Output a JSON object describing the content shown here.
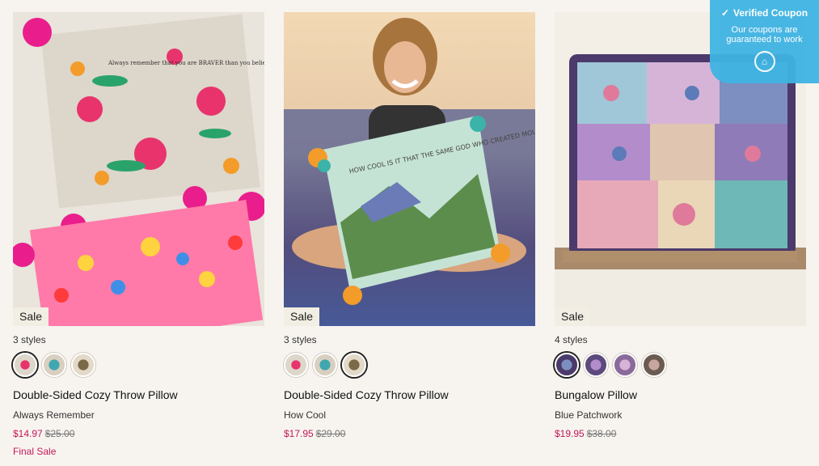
{
  "products": [
    {
      "sale_badge": "Sale",
      "styles_count": "3 styles",
      "title": "Double-Sided Cozy Throw Pillow",
      "variant": "Always Remember",
      "price_now": "$14.97",
      "price_was": "$25.00",
      "final_sale": "Final Sale",
      "pillow_text": "Always remember that you are BRAVER than you believe, STRONGER than you seem, SMARTER than you think and LOVED more than you'll ever know"
    },
    {
      "sale_badge": "Sale",
      "styles_count": "3 styles",
      "title": "Double-Sided Cozy Throw Pillow",
      "variant": "How Cool",
      "price_now": "$17.95",
      "price_was": "$29.00",
      "pillow_text": "HOW COOL IS IT THAT THE SAME GOD WHO CREATED MOUNTAINS AND OCEANS AND GALAXIES LOOKED AT YOU AND THOUGHT THE WORLD NEEDED ONE OF YOU TOO."
    },
    {
      "sale_badge": "Sale",
      "styles_count": "4 styles",
      "title": "Bungalow Pillow",
      "variant": "Blue Patchwork",
      "price_now": "$19.95",
      "price_was": "$38.00"
    }
  ],
  "coupon": {
    "title": "Verified Coupon",
    "text": "Our coupons are guaranteed to work"
  },
  "colors": {
    "sale_price": "#c2185b",
    "coupon_bg": "#3fb4e3"
  }
}
